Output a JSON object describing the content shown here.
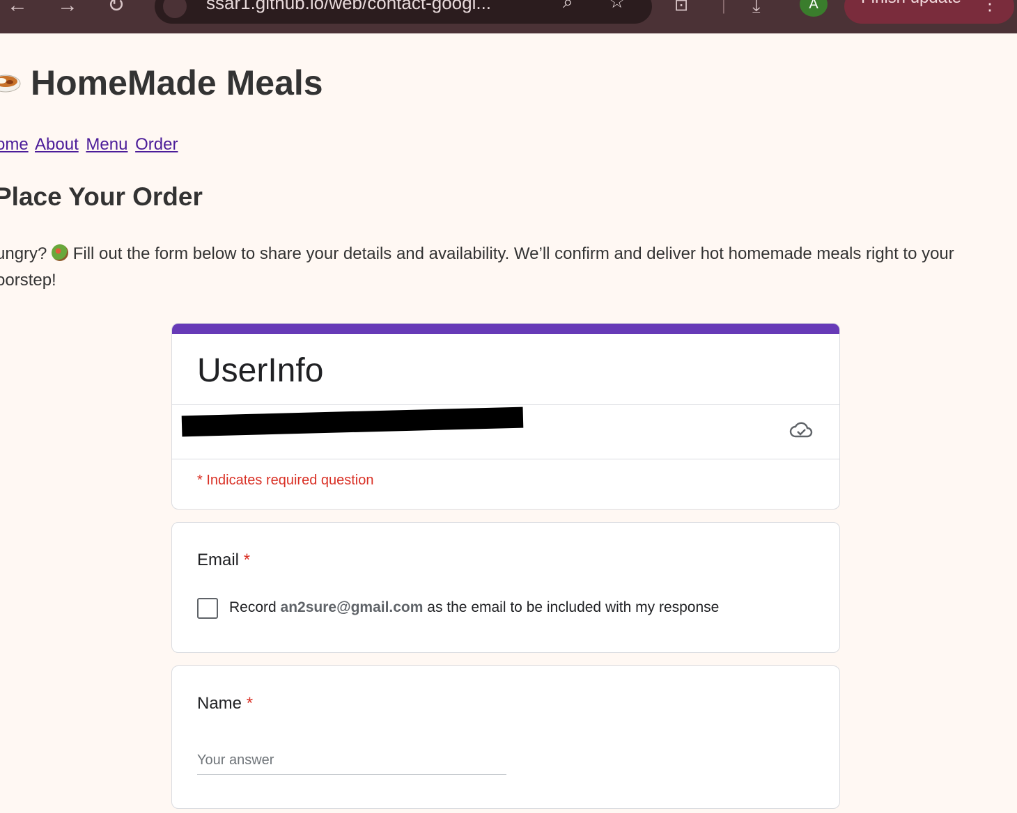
{
  "browser": {
    "url": "ssar1.github.io/web/contact-googl...",
    "avatar_letter": "A",
    "update_label": "Finish update",
    "icons": [
      "back-icon",
      "forward-icon",
      "reload-icon",
      "site-info-icon",
      "search-icon",
      "star-icon",
      "lens-icon",
      "download-icon",
      "more-icon"
    ]
  },
  "site": {
    "title": "HomeMade Meals",
    "logo_icon": "curry-bowl-emoji",
    "nav": [
      "ome",
      "About",
      "Menu",
      "Order"
    ]
  },
  "page": {
    "heading": "Place Your Order",
    "intro_before": "ungry? ",
    "intro_after": " Fill out the form below to share your details and availability. We’ll confirm and deliver hot homemade meals right to your oorstep!"
  },
  "form": {
    "accent_color": "#673ab7",
    "title": "UserInfo",
    "required_note": "* Indicates required question",
    "email_question": {
      "label": "Email",
      "star": "*",
      "check_prefix": "Record",
      "check_email": "an2sure@gmail.com",
      "check_suffix": "as the email to be included with my response",
      "checked": false
    },
    "name_question": {
      "label": "Name",
      "star": "*",
      "placeholder": "Your answer"
    }
  }
}
